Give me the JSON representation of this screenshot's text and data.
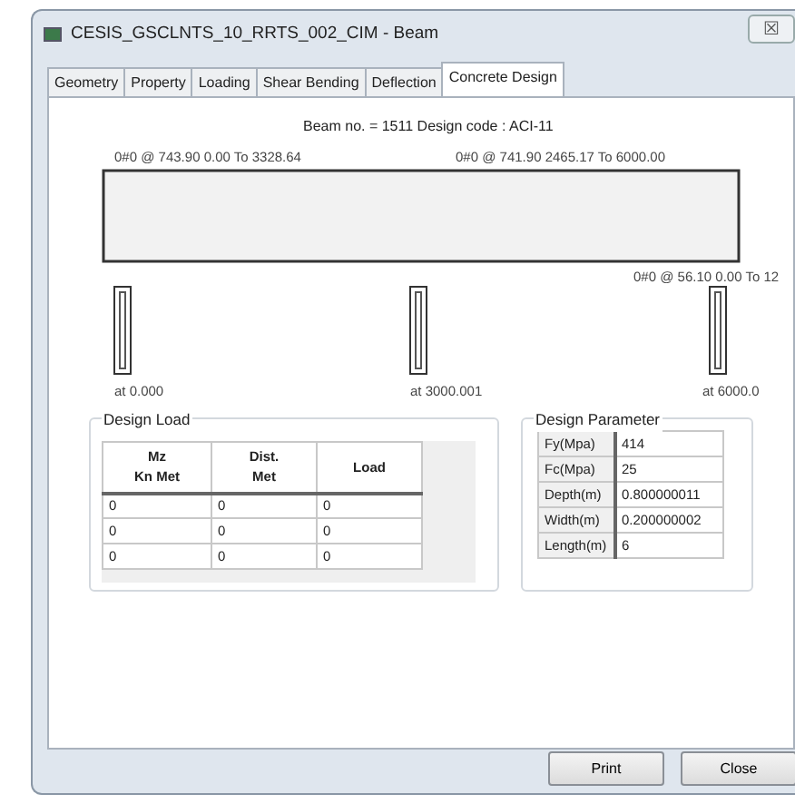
{
  "window": {
    "title": "CESIS_GSCLNTS_10_RRTS_002_CIM - Beam",
    "close_glyph": "☒"
  },
  "tabs": [
    {
      "label": "Geometry",
      "selected": false
    },
    {
      "label": "Property",
      "selected": false
    },
    {
      "label": "Loading",
      "selected": false
    },
    {
      "label": "Shear Bending",
      "selected": false
    },
    {
      "label": "Deflection",
      "selected": false
    },
    {
      "label": "Concrete Design",
      "selected": true
    }
  ],
  "heading": "Beam no. = 1511  Design code :  ACI-11",
  "beam": {
    "top_bars": [
      "0#0 @ 743.90 0.00 To 3328.64",
      "0#0 @ 741.90 2465.17 To 6000.00"
    ],
    "bottom_bar": "0#0 @ 56.10 0.00 To 12",
    "supports": [
      "at 0.000",
      "at 3000.001",
      "at 6000.0"
    ]
  },
  "design_load": {
    "title": "Design Load",
    "columns": [
      "Mz\nKn Met",
      "Dist.\nMet",
      "Load"
    ],
    "rows": [
      [
        "0",
        "0",
        "0"
      ],
      [
        "0",
        "0",
        "0"
      ],
      [
        "0",
        "0",
        "0"
      ]
    ]
  },
  "design_parameter": {
    "title": "Design Parameter",
    "rows": [
      [
        "Fy(Mpa)",
        "414"
      ],
      [
        "Fc(Mpa)",
        "25"
      ],
      [
        "Depth(m)",
        "0.800000011"
      ],
      [
        "Width(m)",
        "0.200000002"
      ],
      [
        "Length(m)",
        "6"
      ]
    ]
  },
  "buttons": [
    "Print",
    "Close"
  ]
}
